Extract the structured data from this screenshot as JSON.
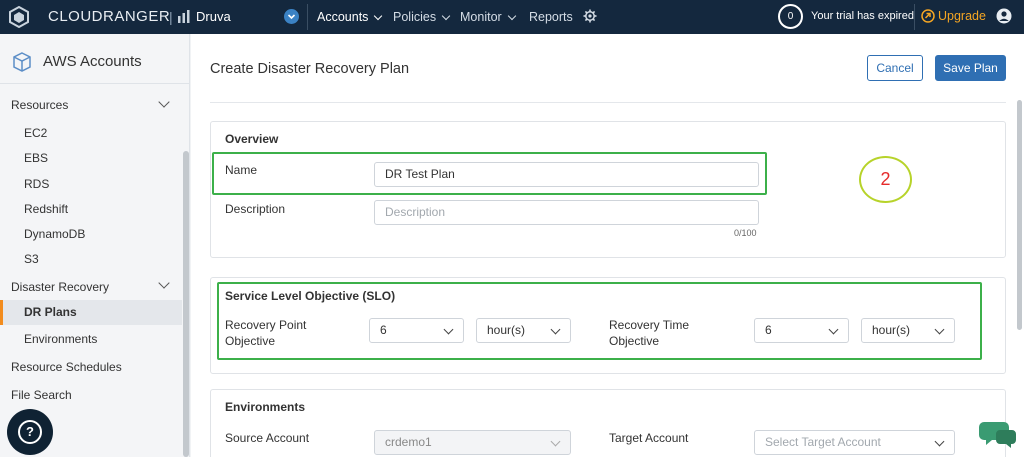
{
  "topbar": {
    "brand": "CLOUDRANGER",
    "org_name": "Druva",
    "nav": [
      "Accounts",
      "Policies",
      "Monitor",
      "Reports"
    ],
    "notification_count": "0",
    "trial_text": "Your trial has expired",
    "upgrade_label": "Upgrade"
  },
  "sidebar": {
    "title": "AWS Accounts",
    "resources_label": "Resources",
    "resources": [
      "EC2",
      "EBS",
      "RDS",
      "Redshift",
      "DynamoDB",
      "S3"
    ],
    "dr_label": "Disaster Recovery",
    "dr_items": [
      "DR Plans",
      "Environments"
    ],
    "schedules_label": "Resource Schedules",
    "file_search_label": "File Search",
    "help_glyph": "?"
  },
  "page": {
    "title": "Create Disaster Recovery Plan",
    "cancel_label": "Cancel",
    "save_label": "Save Plan",
    "step_number": "2"
  },
  "overview": {
    "title": "Overview",
    "name_label": "Name",
    "name_value": "DR Test Plan",
    "description_label": "Description",
    "description_placeholder": "Description",
    "char_counter": "0/100"
  },
  "slo": {
    "title": "Service Level Objective (SLO)",
    "rpo_label_line1": "Recovery Point",
    "rpo_label_line2": "Objective",
    "rpo_value": "6",
    "rpo_unit": "hour(s)",
    "rto_label_line1": "Recovery Time",
    "rto_label_line2": "Objective",
    "rto_value": "6",
    "rto_unit": "hour(s)"
  },
  "environments": {
    "title": "Environments",
    "source_label": "Source Account",
    "source_value": "crdemo1",
    "target_label": "Target Account",
    "target_placeholder": "Select Target Account"
  },
  "colors": {
    "topbar_bg": "#14283e",
    "accent_blue": "#2f6fb3",
    "upgrade_orange": "#f5a623",
    "highlight_green": "#3cb04a",
    "active_marker": "#f28c1e"
  }
}
